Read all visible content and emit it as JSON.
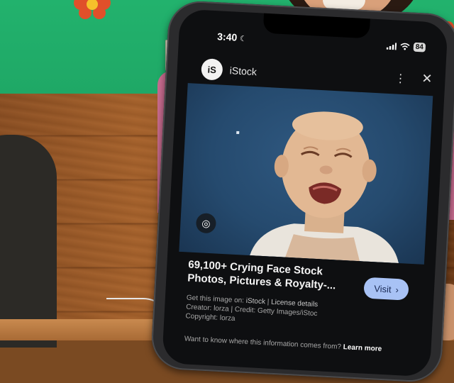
{
  "status_bar": {
    "time": "3:40",
    "moon_icon": "moon-icon",
    "signal_icon": "cellular-signal-icon",
    "wifi_icon": "wifi-icon",
    "battery_level": "84"
  },
  "viewer": {
    "source_name": "iStock",
    "source_logo_text": "iS",
    "more_icon": "more-vert-icon",
    "close_icon": "close-icon",
    "lens_icon": "lens-icon",
    "image_subject": "crying baby photo"
  },
  "result": {
    "title": "69,100+ Crying Face Stock Photos, Pictures & Royalty-...",
    "visit_label": "Visit",
    "visit_icon": "chevron-right-icon",
    "get_image_prefix": "Get this image on:",
    "get_image_source": "iStock",
    "separator": "|",
    "license_link": "License details",
    "creator_line": "Creator: lorza | Credit: Getty Images/iStoc",
    "copyright_line": "Copyright: lorza",
    "learn_text": "Want to know where this information comes from?",
    "learn_more": "Learn more"
  },
  "colors": {
    "wall": "#22b26d",
    "visit_button": "#a8c2f5",
    "photo_background": "#2f5880"
  }
}
